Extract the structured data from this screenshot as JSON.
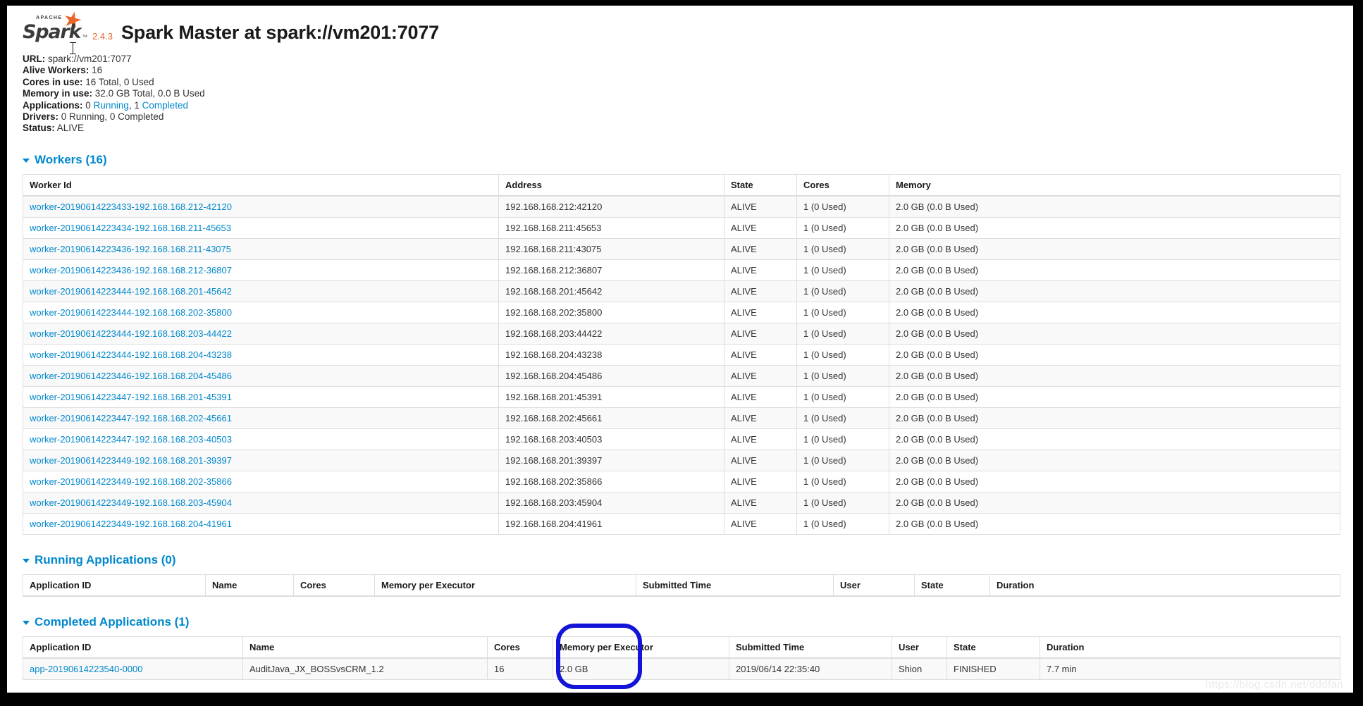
{
  "brand": {
    "apache_label": "APACHE",
    "spark_label": "Spark",
    "trademark": "™",
    "version": "2.4.3",
    "star_glyph": "★",
    "accent_color": "#e8662a",
    "link_color": "#0088cc"
  },
  "header": {
    "title": "Spark Master at spark://vm201:7077"
  },
  "summary": {
    "url_label": "URL:",
    "url_value": "spark://vm201:7077",
    "alive_workers_label": "Alive Workers:",
    "alive_workers_value": "16",
    "cores_label": "Cores in use:",
    "cores_value": "16 Total, 0 Used",
    "memory_label": "Memory in use:",
    "memory_value": "32.0 GB Total, 0.0 B Used",
    "applications_label": "Applications:",
    "applications_running_count": "0",
    "applications_running_link": "Running",
    "applications_sep": ",",
    "applications_completed_count": "1",
    "applications_completed_link": "Completed",
    "drivers_label": "Drivers:",
    "drivers_value": "0 Running, 0 Completed",
    "status_label": "Status:",
    "status_value": "ALIVE"
  },
  "workers_section": {
    "heading": "Workers (16)",
    "columns": [
      "Worker Id",
      "Address",
      "State",
      "Cores",
      "Memory"
    ],
    "rows": [
      [
        "worker-20190614223433-192.168.168.212-42120",
        "192.168.168.212:42120",
        "ALIVE",
        "1 (0 Used)",
        "2.0 GB (0.0 B Used)"
      ],
      [
        "worker-20190614223434-192.168.168.211-45653",
        "192.168.168.211:45653",
        "ALIVE",
        "1 (0 Used)",
        "2.0 GB (0.0 B Used)"
      ],
      [
        "worker-20190614223436-192.168.168.211-43075",
        "192.168.168.211:43075",
        "ALIVE",
        "1 (0 Used)",
        "2.0 GB (0.0 B Used)"
      ],
      [
        "worker-20190614223436-192.168.168.212-36807",
        "192.168.168.212:36807",
        "ALIVE",
        "1 (0 Used)",
        "2.0 GB (0.0 B Used)"
      ],
      [
        "worker-20190614223444-192.168.168.201-45642",
        "192.168.168.201:45642",
        "ALIVE",
        "1 (0 Used)",
        "2.0 GB (0.0 B Used)"
      ],
      [
        "worker-20190614223444-192.168.168.202-35800",
        "192.168.168.202:35800",
        "ALIVE",
        "1 (0 Used)",
        "2.0 GB (0.0 B Used)"
      ],
      [
        "worker-20190614223444-192.168.168.203-44422",
        "192.168.168.203:44422",
        "ALIVE",
        "1 (0 Used)",
        "2.0 GB (0.0 B Used)"
      ],
      [
        "worker-20190614223444-192.168.168.204-43238",
        "192.168.168.204:43238",
        "ALIVE",
        "1 (0 Used)",
        "2.0 GB (0.0 B Used)"
      ],
      [
        "worker-20190614223446-192.168.168.204-45486",
        "192.168.168.204:45486",
        "ALIVE",
        "1 (0 Used)",
        "2.0 GB (0.0 B Used)"
      ],
      [
        "worker-20190614223447-192.168.168.201-45391",
        "192.168.168.201:45391",
        "ALIVE",
        "1 (0 Used)",
        "2.0 GB (0.0 B Used)"
      ],
      [
        "worker-20190614223447-192.168.168.202-45661",
        "192.168.168.202:45661",
        "ALIVE",
        "1 (0 Used)",
        "2.0 GB (0.0 B Used)"
      ],
      [
        "worker-20190614223447-192.168.168.203-40503",
        "192.168.168.203:40503",
        "ALIVE",
        "1 (0 Used)",
        "2.0 GB (0.0 B Used)"
      ],
      [
        "worker-20190614223449-192.168.168.201-39397",
        "192.168.168.201:39397",
        "ALIVE",
        "1 (0 Used)",
        "2.0 GB (0.0 B Used)"
      ],
      [
        "worker-20190614223449-192.168.168.202-35866",
        "192.168.168.202:35866",
        "ALIVE",
        "1 (0 Used)",
        "2.0 GB (0.0 B Used)"
      ],
      [
        "worker-20190614223449-192.168.168.203-45904",
        "192.168.168.203:45904",
        "ALIVE",
        "1 (0 Used)",
        "2.0 GB (0.0 B Used)"
      ],
      [
        "worker-20190614223449-192.168.168.204-41961",
        "192.168.168.204:41961",
        "ALIVE",
        "1 (0 Used)",
        "2.0 GB (0.0 B Used)"
      ]
    ]
  },
  "running_section": {
    "heading": "Running Applications (0)",
    "columns": [
      "Application ID",
      "Name",
      "Cores",
      "Memory per Executor",
      "Submitted Time",
      "User",
      "State",
      "Duration"
    ],
    "rows": []
  },
  "completed_section": {
    "heading": "Completed Applications (1)",
    "columns": [
      "Application ID",
      "Name",
      "Cores",
      "Memory per Executor",
      "Submitted Time",
      "User",
      "State",
      "Duration"
    ],
    "rows": [
      [
        "app-20190614223540-0000",
        "AuditJava_JX_BOSSvsCRM_1.2",
        "16",
        "2.0 GB",
        "2019/06/14 22:35:40",
        "Shion",
        "FINISHED",
        "7.7 min"
      ]
    ]
  },
  "annotation": {
    "shape": "oval",
    "color": "#1414d8",
    "target_column": "Cores"
  },
  "watermark": {
    "text": "https://blog.csdn.net/dddfan"
  }
}
